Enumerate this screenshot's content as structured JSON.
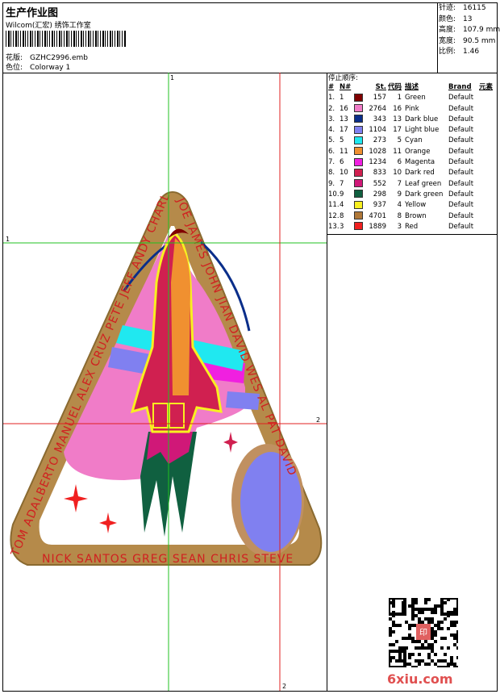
{
  "header": {
    "title": "生产作业图",
    "subtitle": "Wilcom(汇宏) 绣饰工作室",
    "design_label": "花版:",
    "design_value": "GZHC2996.emb",
    "colorway_label": "色位:",
    "colorway_value": "Colorway 1"
  },
  "stats": [
    {
      "label": "针迹:",
      "value": "16115"
    },
    {
      "label": "颜色:",
      "value": "13"
    },
    {
      "label": "高度:",
      "value": "107.9 mm"
    },
    {
      "label": "宽度:",
      "value": "90.5 mm"
    },
    {
      "label": "比例:",
      "value": "1.46"
    }
  ],
  "panel": {
    "title": "停止顺序:",
    "headers": {
      "idx": "#",
      "needle": "N#",
      "st": "St.",
      "code": "代码",
      "desc": "描述",
      "brand": "Brand",
      "elem": "元素"
    },
    "rows": [
      {
        "idx": "1.",
        "needle": "1",
        "color": "#800000",
        "st": "157",
        "code": "1",
        "desc": "Green",
        "brand": "Default"
      },
      {
        "idx": "2.",
        "needle": "16",
        "color": "#f07cc8",
        "st": "2764",
        "code": "16",
        "desc": "Pink",
        "brand": "Default"
      },
      {
        "idx": "3.",
        "needle": "13",
        "color": "#0a2e8a",
        "st": "343",
        "code": "13",
        "desc": "Dark blue",
        "brand": "Default"
      },
      {
        "idx": "4.",
        "needle": "17",
        "color": "#8080f0",
        "st": "1104",
        "code": "17",
        "desc": "Light blue",
        "brand": "Default"
      },
      {
        "idx": "5.",
        "needle": "5",
        "color": "#20e8f0",
        "st": "273",
        "code": "5",
        "desc": "Cyan",
        "brand": "Default"
      },
      {
        "idx": "6.",
        "needle": "11",
        "color": "#f09030",
        "st": "1028",
        "code": "11",
        "desc": "Orange",
        "brand": "Default"
      },
      {
        "idx": "7.",
        "needle": "6",
        "color": "#f020e0",
        "st": "1234",
        "code": "6",
        "desc": "Magenta",
        "brand": "Default"
      },
      {
        "idx": "8.",
        "needle": "10",
        "color": "#d02050",
        "st": "833",
        "code": "10",
        "desc": "Dark red",
        "brand": "Default"
      },
      {
        "idx": "9.",
        "needle": "7",
        "color": "#d01878",
        "st": "552",
        "code": "7",
        "desc": "Leaf green",
        "brand": "Default"
      },
      {
        "idx": "10.",
        "needle": "9",
        "color": "#106040",
        "st": "298",
        "code": "9",
        "desc": "Dark green",
        "brand": "Default"
      },
      {
        "idx": "11.",
        "needle": "4",
        "color": "#f8f020",
        "st": "937",
        "code": "4",
        "desc": "Yellow",
        "brand": "Default"
      },
      {
        "idx": "12.",
        "needle": "8",
        "color": "#b07838",
        "st": "4701",
        "code": "8",
        "desc": "Brown",
        "brand": "Default"
      },
      {
        "idx": "13.",
        "needle": "3",
        "color": "#f02020",
        "st": "1889",
        "code": "3",
        "desc": "Red",
        "brand": "Default"
      }
    ]
  },
  "guides": {
    "v1": "1",
    "h1": "1",
    "v2": "2",
    "h2": "2"
  },
  "patch": {
    "left_names": "TOM ADALBERTO MANUEL ALEX CRUZ PETE JEFF ANDY CHARLIE",
    "right_names": "JOE JAMES JOHN JIAN DAVID WES AL PAT DAVID",
    "bottom_names": "NICK SANTOS GREG SEAN CHRIS STEVE"
  },
  "watermark": "6xiu.com",
  "qr_label": "印"
}
